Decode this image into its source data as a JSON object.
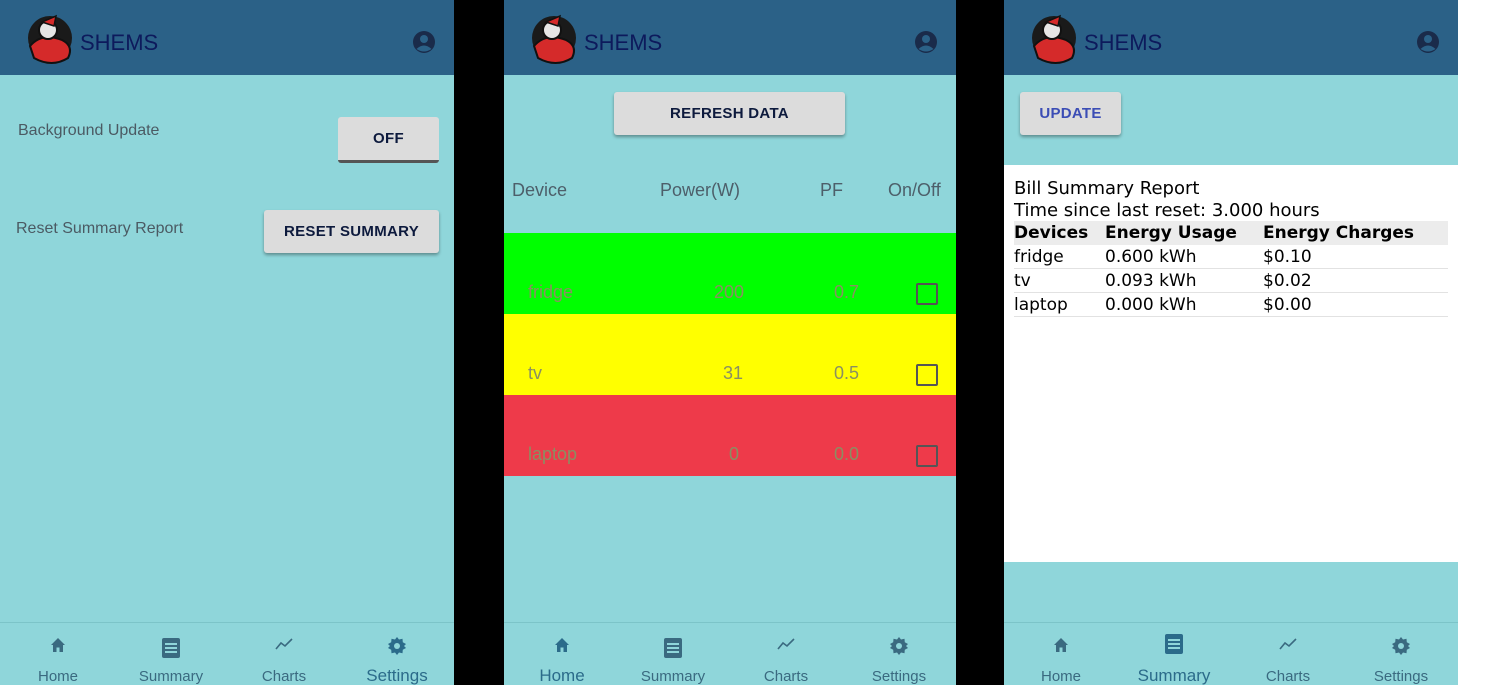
{
  "app": {
    "name": "SHEMS"
  },
  "colors": {
    "header": "#2b6187",
    "background": "#8fd6da",
    "row_fridge": "#00ff00",
    "row_tv": "#ffff00",
    "row_laptop": "#ee3a4a"
  },
  "nav": {
    "home": "Home",
    "summary": "Summary",
    "charts": "Charts",
    "settings": "Settings"
  },
  "settings_screen": {
    "background_update_label": "Background Update",
    "background_update_value": "OFF",
    "reset_label": "Reset Summary Report",
    "reset_button": "RESET SUMMARY",
    "active_tab": "Settings"
  },
  "home_screen": {
    "refresh_button": "REFRESH DATA",
    "columns": {
      "device": "Device",
      "power": "Power(W)",
      "pf": "PF",
      "onoff": "On/Off"
    },
    "devices": [
      {
        "name": "fridge",
        "power": "200",
        "pf": "0.7",
        "on": false
      },
      {
        "name": "tv",
        "power": "31",
        "pf": "0.5",
        "on": false
      },
      {
        "name": "laptop",
        "power": "0",
        "pf": "0.0",
        "on": false
      }
    ],
    "active_tab": "Home"
  },
  "summary_screen": {
    "update_button": "UPDATE",
    "report_title": "Bill Summary Report",
    "time_since_reset": "Time since last reset: 3.000 hours",
    "columns": {
      "devices": "Devices",
      "energy_usage": "Energy Usage",
      "energy_charges": "Energy Charges"
    },
    "rows": [
      {
        "device": "fridge",
        "usage": "0.600 kWh",
        "charges": "$0.10"
      },
      {
        "device": "tv",
        "usage": "0.093 kWh",
        "charges": "$0.02"
      },
      {
        "device": "laptop",
        "usage": "0.000 kWh",
        "charges": "$0.00"
      }
    ],
    "active_tab": "Summary"
  }
}
